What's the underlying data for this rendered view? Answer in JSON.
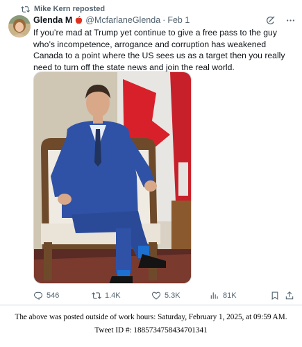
{
  "repost": {
    "text": "Mike Kern reposted"
  },
  "tweet": {
    "author_name": "Glenda M",
    "handle": "@McfarlaneGlenda",
    "separator": "·",
    "date": "Feb 1",
    "text": "If you’re mad at Trump yet continue to give a free pass to the guy who’s incompetence, arrogance and corruption has weakened Canada to a point where the US sees us as a target then you really need to turn off the state news and join the real world."
  },
  "stats": {
    "replies": "546",
    "reposts": "1.4K",
    "likes": "5.3K",
    "views": "81K"
  },
  "icons": {
    "repost": "repost-icon",
    "grok": "grok-icon",
    "more": "more-icon",
    "reply": "reply-icon",
    "like": "heart-icon",
    "views": "views-icon",
    "bookmark": "bookmark-icon",
    "share": "share-icon",
    "name_emoji": "apple-emoji"
  },
  "colors": {
    "secondary_text": "#536471",
    "emoji_red": "#e0301e"
  },
  "footer": {
    "line1": "The above was posted outside of work hours: Saturday, February 1, 2025, at 09:59 AM.",
    "line2": "Tweet ID #: 1885734758434701341"
  }
}
